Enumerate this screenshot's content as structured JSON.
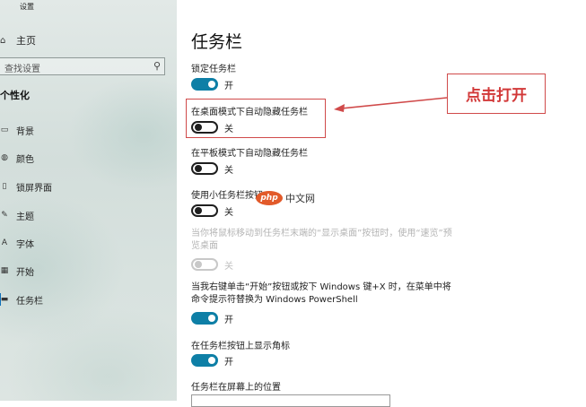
{
  "sidebar": {
    "app_title": "设置",
    "home_label": "主页",
    "search_placeholder": "查找设置",
    "section_title": "个性化",
    "items": [
      {
        "label": "背景",
        "icon": "picture-icon"
      },
      {
        "label": "颜色",
        "icon": "palette-icon"
      },
      {
        "label": "锁屏界面",
        "icon": "lock-screen-icon"
      },
      {
        "label": "主题",
        "icon": "theme-icon"
      },
      {
        "label": "字体",
        "icon": "font-icon"
      },
      {
        "label": "开始",
        "icon": "start-icon"
      },
      {
        "label": "任务栏",
        "icon": "taskbar-icon"
      }
    ],
    "active_item": "任务栏"
  },
  "main": {
    "title": "任务栏",
    "settings": [
      {
        "label": "锁定任务栏",
        "state": "开",
        "on": true
      },
      {
        "label": "在桌面模式下自动隐藏任务栏",
        "state": "关",
        "on": false
      },
      {
        "label": "在平板模式下自动隐藏任务栏",
        "state": "关",
        "on": false
      },
      {
        "label": "使用小任务栏按钮",
        "state": "关",
        "on": false
      },
      {
        "label": "当你将鼠标移动到任务栏末端的“显示桌面”按钮时，使用“速览”预览桌面",
        "state": "关",
        "on": false,
        "disabled": true
      },
      {
        "label": "当我右键单击“开始”按钮或按下 Windows 键+X 时，在菜单中将命令提示符替换为 Windows PowerShell",
        "state": "开",
        "on": true
      },
      {
        "label": "在任务栏按钮上显示角标",
        "state": "开",
        "on": true
      },
      {
        "label": "任务栏在屏幕上的位置"
      }
    ]
  },
  "annotation": {
    "callout_text": "点击打开",
    "color": "#d04a4a"
  },
  "watermark": {
    "logo": "php",
    "text": "中文网"
  },
  "colors": {
    "toggle_on": "#0e7fa6",
    "accent": "#0f6fb8"
  }
}
